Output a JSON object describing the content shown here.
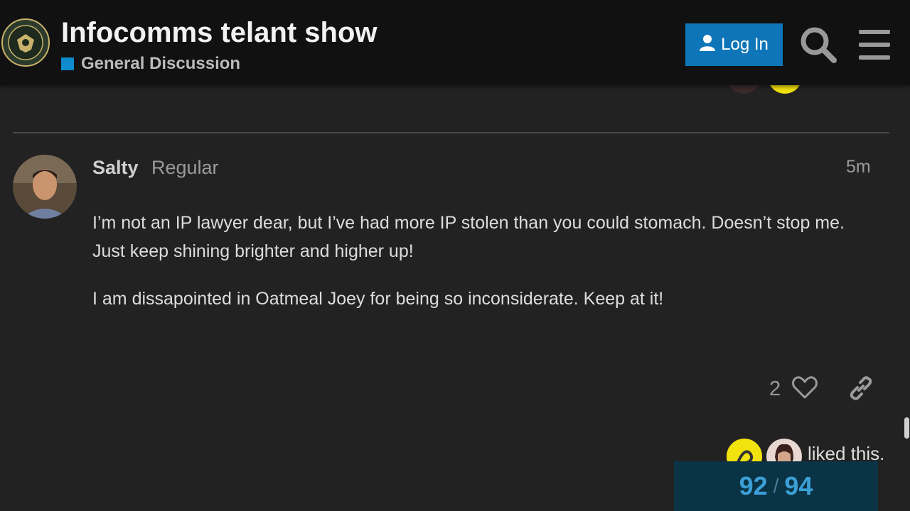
{
  "header": {
    "title": "Infocomms telant show",
    "category": {
      "label": "General Discussion",
      "color": "#0e8ccd"
    },
    "login_label": "Log In"
  },
  "post": {
    "username": "Salty",
    "user_title": "Regular",
    "time": "5m",
    "paragraphs": [
      "I’m not an IP lawyer dear, but I’ve had more IP stolen than you could stomach. Doesn’t stop me. Just keep shining brighter and higher up!",
      "I am dissapointed in Oatmeal Joey for being so inconsiderate. Keep at it!"
    ],
    "like_count": "2",
    "liked_text": "liked this."
  },
  "progress": {
    "current": "92",
    "separator": "/",
    "total": "94"
  },
  "icons": [
    "user-icon",
    "search-icon",
    "hamburger-menu-icon",
    "heart-icon",
    "link-icon"
  ],
  "colors": {
    "login_button": "#0e76b8",
    "accent_blue": "#3c9fd6",
    "background": "#222222",
    "header": "#111111"
  }
}
